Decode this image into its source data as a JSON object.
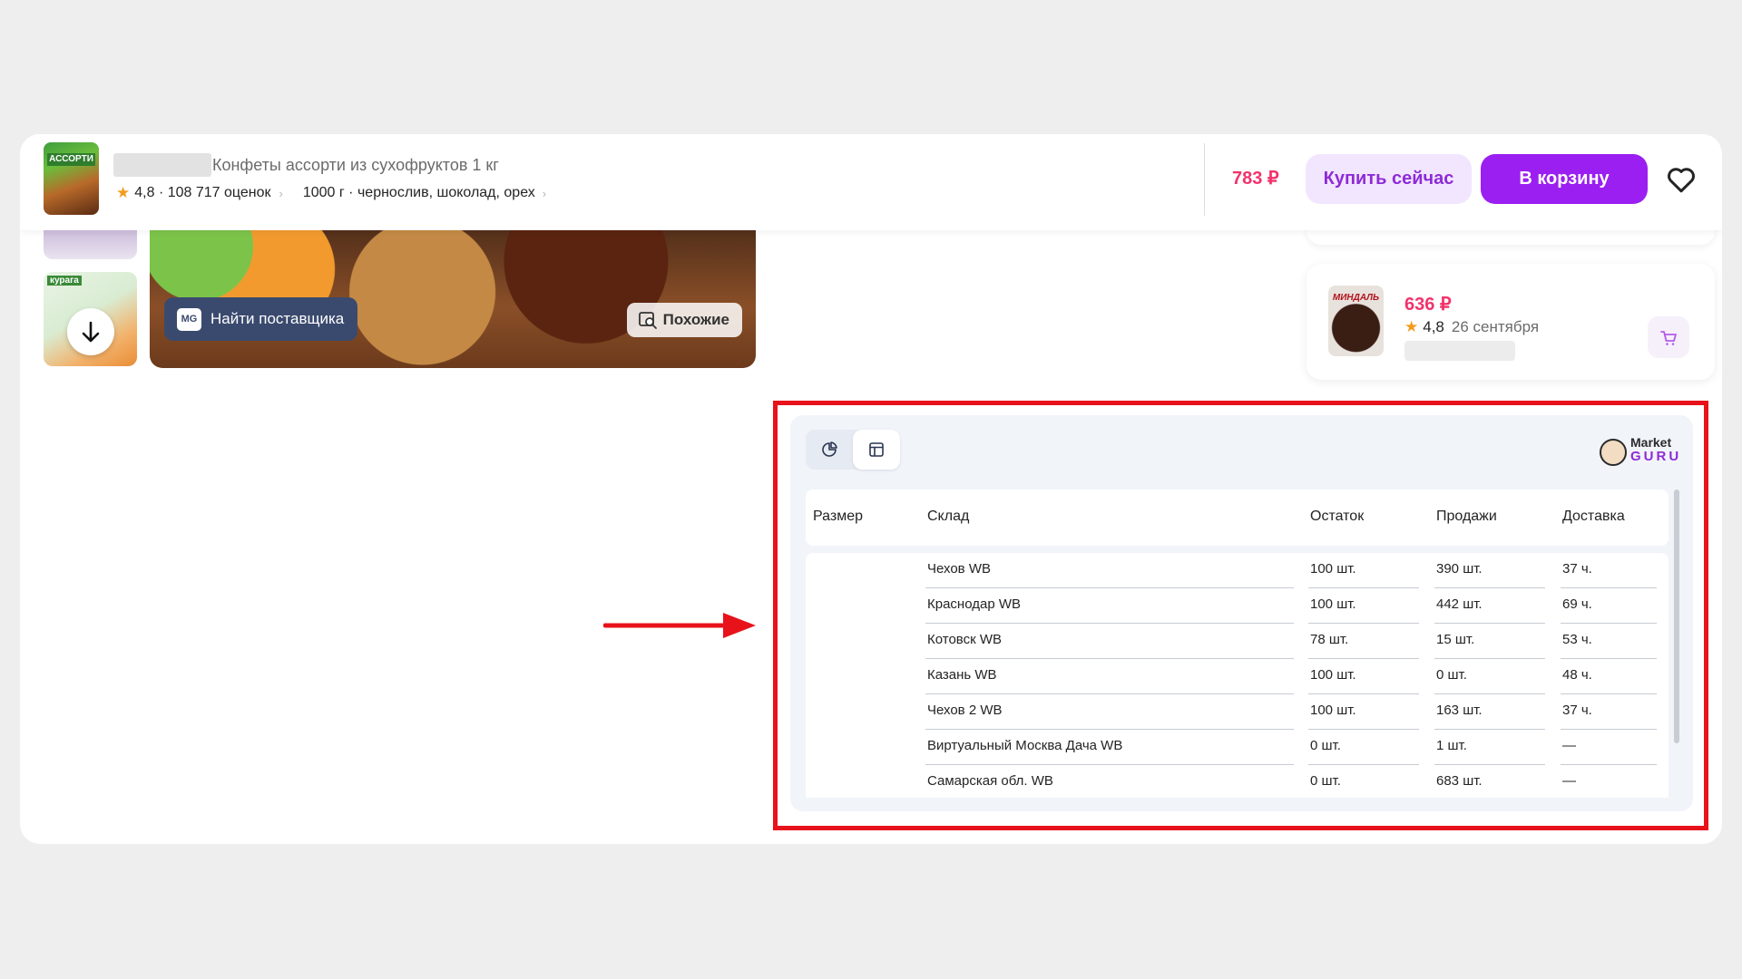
{
  "product_bar": {
    "title": "Конфеты ассорти из сухофруктов 1 кг",
    "thumb_text": "АССОРТИ",
    "rating": "4,8 · 108 717 оценок",
    "spec": "1000 г · чернослив, шоколад, орех",
    "price": "783 ₽",
    "buy_now_label": "Купить сейчас",
    "add_to_cart_label": "В корзину",
    "favorite_icon": "heart-icon"
  },
  "gallery": {
    "thumb_label": "курага",
    "find_supplier_badge": "MG",
    "find_supplier_label": "Найти поставщика",
    "similar_label": "Похожие"
  },
  "recommendation": {
    "image_label": "МИНДАЛЬ",
    "price": "636 ₽",
    "rating": "4,8",
    "date": "26 сентября"
  },
  "panel": {
    "logo_line1": "Market",
    "logo_line2": "GURU",
    "columns": [
      "Размер",
      "Склад",
      "Остаток",
      "Продажи",
      "Доставка"
    ],
    "rows": [
      {
        "size": "",
        "warehouse": "Чехов WB",
        "stock": "100 шт.",
        "sales": "390 шт.",
        "delivery": "37 ч."
      },
      {
        "size": "",
        "warehouse": "Краснодар WB",
        "stock": "100 шт.",
        "sales": "442 шт.",
        "delivery": "69 ч."
      },
      {
        "size": "",
        "warehouse": "Котовск WB",
        "stock": "78 шт.",
        "sales": "15 шт.",
        "delivery": "53 ч."
      },
      {
        "size": "",
        "warehouse": "Казань WB",
        "stock": "100 шт.",
        "sales": "0 шт.",
        "delivery": "48 ч."
      },
      {
        "size": "",
        "warehouse": "Чехов 2 WB",
        "stock": "100 шт.",
        "sales": "163 шт.",
        "delivery": "37 ч."
      },
      {
        "size": "",
        "warehouse": "Виртуальный Москва Дача WB",
        "stock": "0 шт.",
        "sales": "1 шт.",
        "delivery": "—"
      },
      {
        "size": "",
        "warehouse": "Самарская обл. WB",
        "stock": "0 шт.",
        "sales": "683 шт.",
        "delivery": "—"
      }
    ]
  },
  "colors": {
    "accent_purple": "#9a1ff0",
    "price_pink": "#f2336b",
    "annotation_red": "#e8121a"
  }
}
